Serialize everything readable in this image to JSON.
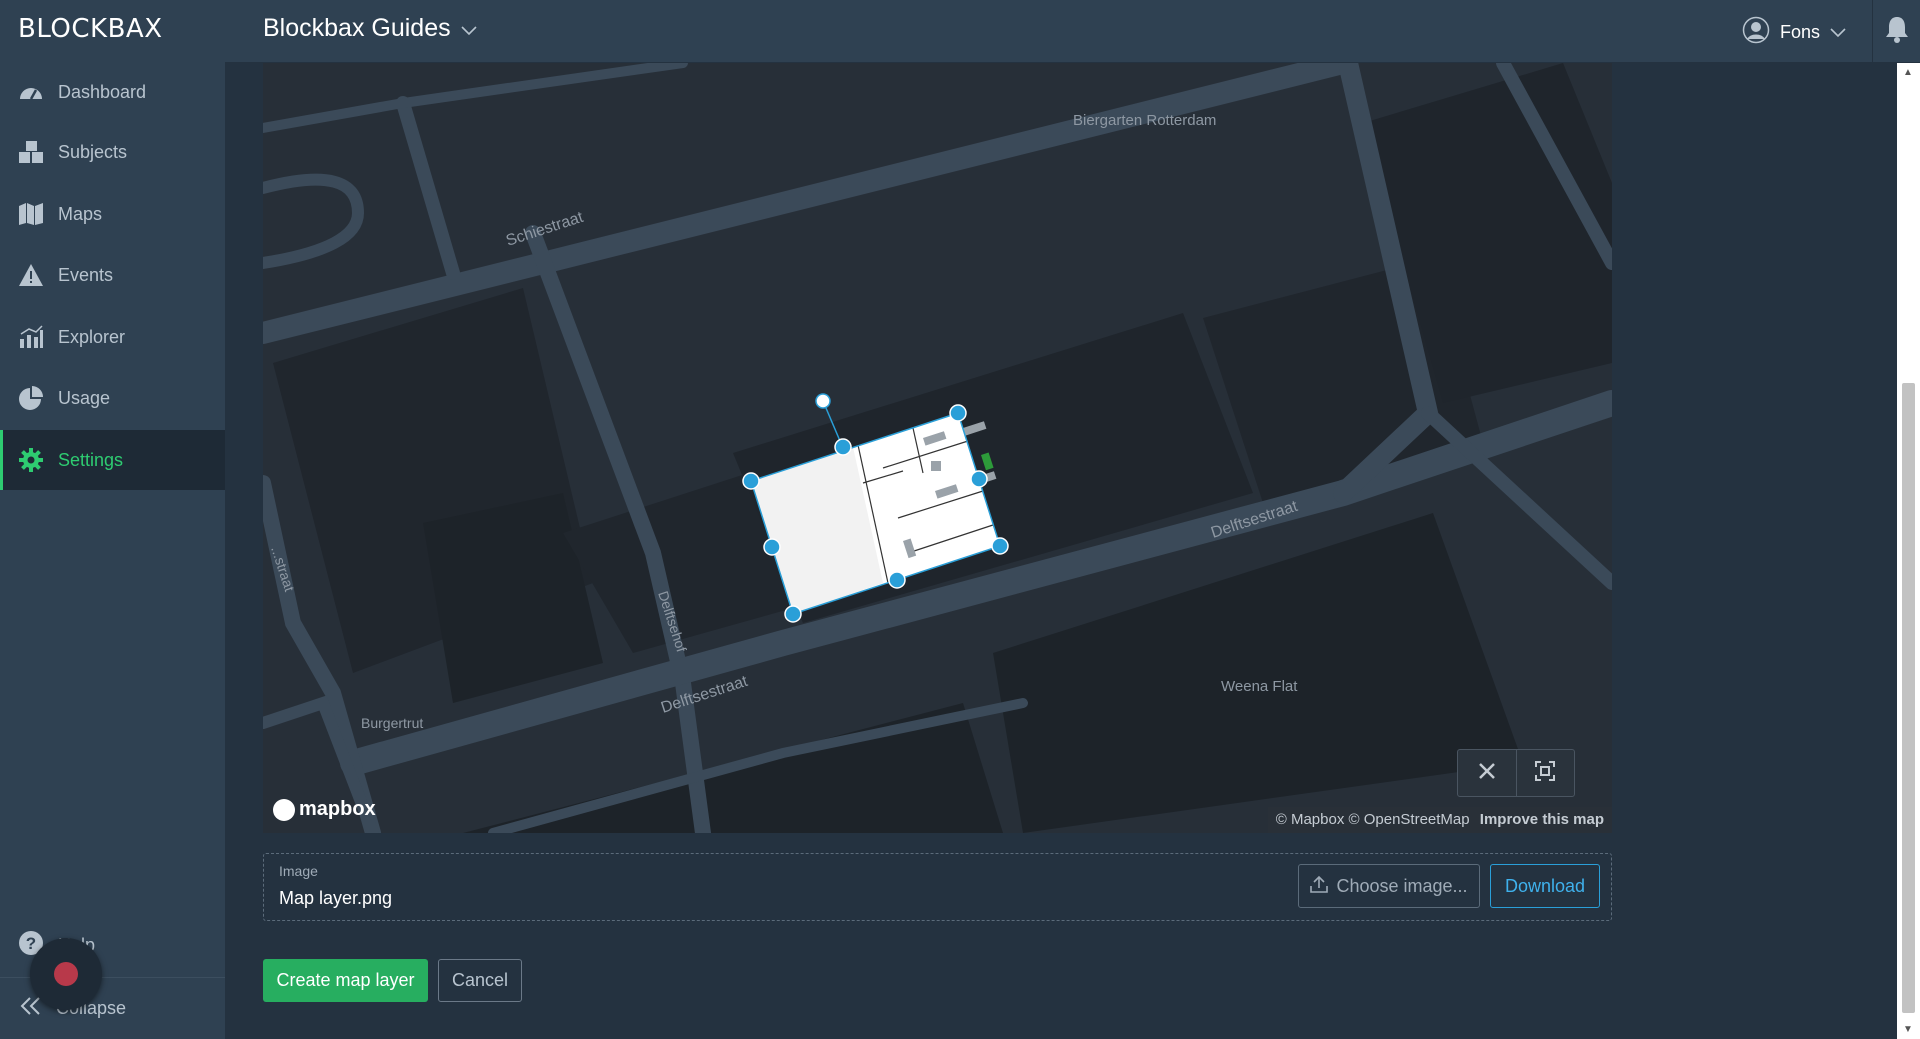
{
  "app": {
    "logo": "BLOCKBAX"
  },
  "sidebar": {
    "items": [
      {
        "label": "Dashboard",
        "icon": "dashboard-gauge-icon"
      },
      {
        "label": "Subjects",
        "icon": "subjects-cubes-icon"
      },
      {
        "label": "Maps",
        "icon": "maps-icon"
      },
      {
        "label": "Events",
        "icon": "warning-triangle-icon"
      },
      {
        "label": "Explorer",
        "icon": "chart-icon"
      },
      {
        "label": "Usage",
        "icon": "pie-chart-icon"
      },
      {
        "label": "Settings",
        "icon": "gear-icon",
        "active": true
      }
    ],
    "help_label": "Help",
    "collapse_label": "Collapse"
  },
  "header": {
    "project": "Blockbax Guides",
    "user": "Fons"
  },
  "map": {
    "labels": {
      "biergarten": "Biergarten Rotterdam",
      "schiestraat": "Schiestraat",
      "delftsestraat_right": "Delftsestraat",
      "delftsestraat_bottom": "Delftsestraat",
      "delftsehof": "Delftsehof",
      "weena_flat": "Weena Flat",
      "burgertrut": "Burgertrut",
      "left_street": "...straat"
    },
    "attribution": "© Mapbox © OpenStreetMap",
    "improve": "Improve this map",
    "mapbox_logo": "mapbox"
  },
  "image_field": {
    "caption": "Image",
    "value": "Map layer.png",
    "choose_label": "Choose image...",
    "download_label": "Download"
  },
  "actions": {
    "create_label": "Create map layer",
    "cancel_label": "Cancel"
  },
  "colors": {
    "accent_green": "#27ae60",
    "accent_blue": "#3fb1ec",
    "sidebar_bg": "#2f4152"
  }
}
